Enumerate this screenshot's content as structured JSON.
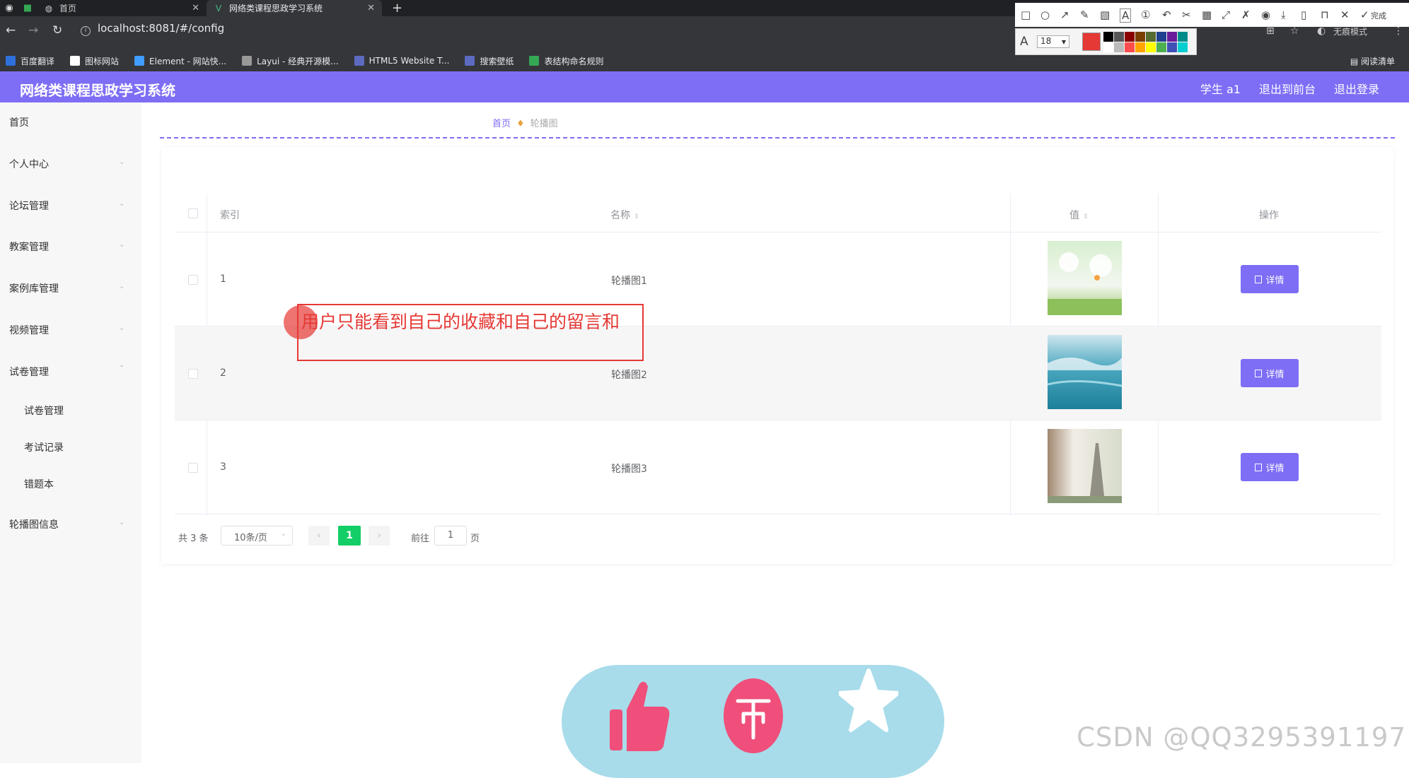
{
  "browser": {
    "tabs": [
      {
        "title": "首页"
      },
      {
        "title": "网络类课程思政学习系统"
      }
    ],
    "url": "localhost:8081/#/config",
    "incognito_label": "无痕模式",
    "bookmarks": [
      {
        "label": "百度翻译",
        "color": "#2f6fdb"
      },
      {
        "label": "图标网站",
        "color": "#ffffff"
      },
      {
        "label": "Element - 网站快...",
        "color": "#409eff"
      },
      {
        "label": "Layui - 经典开源模...",
        "color": "#999999"
      },
      {
        "label": "HTML5 Website T...",
        "color": "#5c6bc0"
      },
      {
        "label": "搜索壁纸",
        "color": "#5c6bc0"
      },
      {
        "label": "表结构命名规则",
        "color": "#34a853"
      }
    ],
    "reading_list": "阅读清单"
  },
  "snip_tool": {
    "font_size": "18",
    "done_label": "完成",
    "active_color": "#e53935",
    "palette": [
      "#000000",
      "#555555",
      "#8b0000",
      "#7a3e00",
      "#556b2f",
      "#1f3f8f",
      "#6a1b9a",
      "#008b8b",
      "#ffffff",
      "#bbbbbb",
      "#ff4d4d",
      "#ffa500",
      "#ffff00",
      "#4caf50",
      "#3f51b5",
      "#00ced1"
    ]
  },
  "header": {
    "title": "网络类课程思政学习系统",
    "user": "学生 a1",
    "to_front": "退出到前台",
    "logout": "退出登录",
    "color": "#7d6ef5"
  },
  "sidebar": {
    "items": [
      {
        "label": "首页"
      },
      {
        "label": "个人中心"
      },
      {
        "label": "论坛管理"
      },
      {
        "label": "教案管理"
      },
      {
        "label": "案例库管理"
      },
      {
        "label": "视频管理"
      },
      {
        "label": "试卷管理"
      },
      {
        "label": "试卷管理"
      },
      {
        "label": "考试记录"
      },
      {
        "label": "错题本"
      },
      {
        "label": "轮播图信息"
      }
    ]
  },
  "breadcrumb": {
    "home": "首页",
    "current": "轮播图"
  },
  "table": {
    "headers": {
      "index": "索引",
      "name": "名称",
      "value": "值",
      "action": "操作"
    },
    "rows": [
      {
        "index": "1",
        "name": "轮播图1",
        "action": "详情"
      },
      {
        "index": "2",
        "name": "轮播图2",
        "action": "详情"
      },
      {
        "index": "3",
        "name": "轮播图3",
        "action": "详情"
      }
    ]
  },
  "pagination": {
    "total": "共 3 条",
    "page_size": "10条/页",
    "current": "1",
    "goto_label": "前往",
    "goto_value": "1",
    "page_label": "页"
  },
  "annotation": {
    "text": "用户只能看到自己的收藏和自己的留言和"
  },
  "watermark": "CSDN @QQ3295391197"
}
